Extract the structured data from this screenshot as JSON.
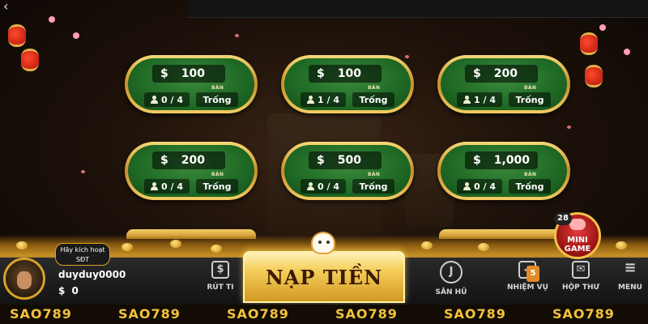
{
  "tables": [
    {
      "bet": "100",
      "players": "0 / 4",
      "ban_label": "BÀN",
      "status": "Trống"
    },
    {
      "bet": "100",
      "players": "1 / 4",
      "ban_label": "BÀN",
      "status": "Trống"
    },
    {
      "bet": "200",
      "players": "1 / 4",
      "ban_label": "BÀN",
      "status": "Trống"
    },
    {
      "bet": "200",
      "players": "0 / 4",
      "ban_label": "BÀN",
      "status": "Trống"
    },
    {
      "bet": "500",
      "players": "0 / 4",
      "ban_label": "BÀN",
      "status": "Trống"
    },
    {
      "bet": "1,000",
      "players": "0 / 4",
      "ban_label": "BÀN",
      "status": "Trống"
    }
  ],
  "currency_symbol": "$",
  "user": {
    "verify_line1": "Hãy kích hoạt",
    "verify_line2": "SĐT",
    "username": "duyduy0000",
    "balance": "0"
  },
  "nav": {
    "rut_tien": "RÚT TI",
    "nap_tien": "NẠP TIỀN",
    "san_hu": "SĂN HŨ",
    "nhiem_vu": "NHIỆM VỤ",
    "nhiem_vu_badge": "5",
    "hop_thu": "HỘP THƯ",
    "menu": "MENU"
  },
  "mini_game": {
    "count": "28",
    "line1": "MINI",
    "line2": "GAME"
  },
  "watermark": "SAO789",
  "colors": {
    "table_felt": "#1f6a25",
    "gold": "#d7a22a",
    "watermark": "#f2c23a"
  },
  "icons": {
    "back": "back-arrow-icon",
    "player": "person-icon",
    "rut_tien": "withdraw-icon",
    "san_hu": "jackpot-icon",
    "nhiem_vu": "mission-icon",
    "hop_thu": "mail-icon",
    "menu": "hamburger-icon"
  }
}
